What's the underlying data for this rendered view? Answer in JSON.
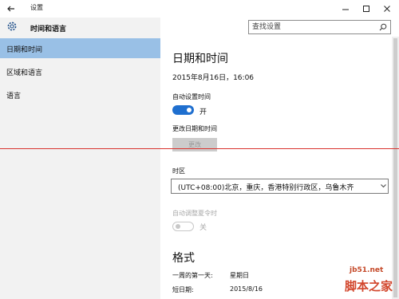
{
  "window": {
    "title": "设置"
  },
  "app": {
    "title": "时间和语言",
    "icon": "gear-icon"
  },
  "search": {
    "placeholder": "查找设置",
    "icon": "search-icon"
  },
  "sidebar": {
    "items": [
      {
        "label": "日期和时间",
        "active": true
      },
      {
        "label": "区域和语言",
        "active": false
      },
      {
        "label": "语言",
        "active": false
      }
    ]
  },
  "main": {
    "heading": "日期和时间",
    "current_datetime": "2015年8月16日，16:06",
    "auto_time": {
      "label": "自动设置时间",
      "state": "开",
      "on": true
    },
    "change_datetime": {
      "label": "更改日期和时间",
      "button": "更改",
      "enabled": false
    },
    "timezone": {
      "label": "时区",
      "value": "(UTC+08:00)北京，重庆，香港特别行政区，乌鲁木齐"
    },
    "auto_dst": {
      "label": "自动调整夏令时",
      "state": "关",
      "on": false,
      "enabled": false
    },
    "format": {
      "heading": "格式",
      "first_day_label": "一周的第一天:",
      "first_day_value": "星期日",
      "short_date_label": "短日期:",
      "short_date_value": "2015/8/16"
    }
  },
  "watermark": {
    "url": "jb51.net",
    "text": "脚本之家"
  },
  "colors": {
    "accent": "#1f6fcf",
    "nav_selected": "#99c0e6",
    "sidebar_bg": "#f2f2f2",
    "annotation_line": "#d9342f"
  }
}
